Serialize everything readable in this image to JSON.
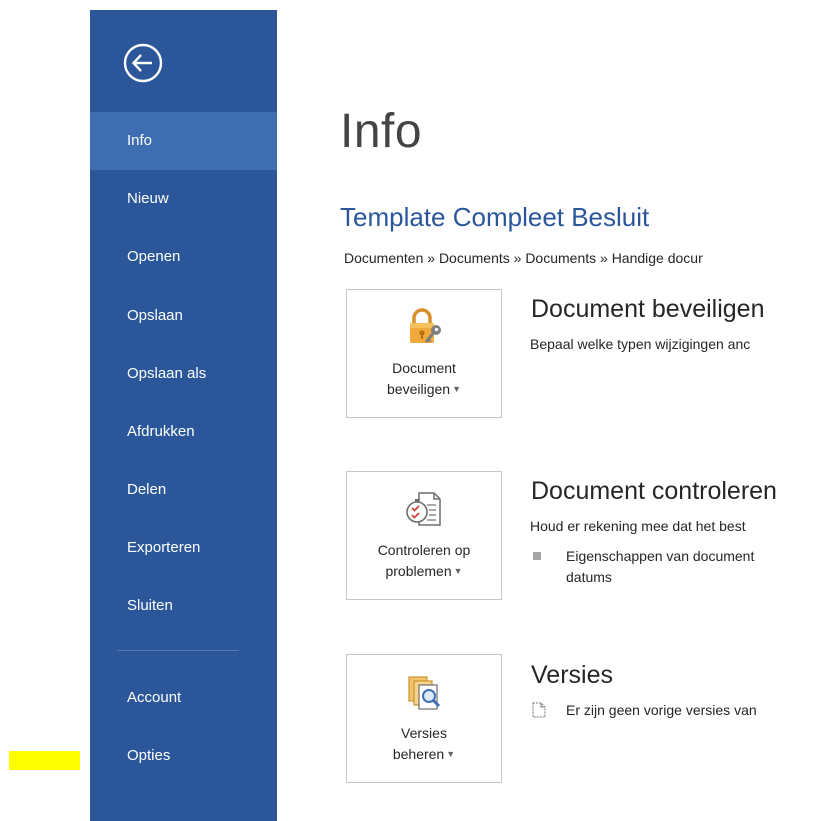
{
  "colors": {
    "nav_background": "#2b579a",
    "nav_active": "#3f6db2",
    "accent": "#2b579a",
    "highlight": "#ffff00"
  },
  "nav": {
    "back_icon": "back-arrow-circle-icon",
    "items": [
      {
        "label": "Info",
        "active": true
      },
      {
        "label": "Nieuw"
      },
      {
        "label": "Openen"
      },
      {
        "label": "Opslaan"
      },
      {
        "label": "Opslaan als"
      },
      {
        "label": "Afdrukken"
      },
      {
        "label": "Delen"
      },
      {
        "label": "Exporteren"
      },
      {
        "label": "Sluiten"
      },
      {
        "label": "Account"
      },
      {
        "label": "Opties"
      }
    ]
  },
  "main": {
    "title": "Info",
    "document_title": "Template Compleet Besluit",
    "breadcrumb": "Documenten » Documents » Documents » Handige docur",
    "sections": [
      {
        "button_line1": "Document",
        "button_line2": "beveiligen",
        "icon": "padlock-key-icon",
        "heading": "Document beveiligen",
        "description": "Bepaal welke typen wijzigingen anc"
      },
      {
        "button_line1": "Controleren op",
        "button_line2": "problemen",
        "icon": "inspect-document-icon",
        "heading": "Document controleren",
        "description": "Houd er rekening mee dat het best",
        "bullet_line1": "Eigenschappen van document",
        "bullet_line2": "datums"
      },
      {
        "button_line1": "Versies",
        "button_line2": "beheren",
        "icon": "manage-versions-icon",
        "heading": "Versies",
        "description": "Er zijn geen vorige versies van"
      }
    ]
  }
}
